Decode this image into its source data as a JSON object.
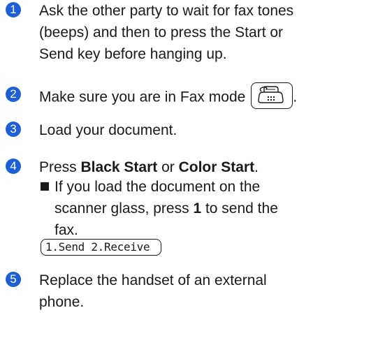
{
  "steps": [
    {
      "num": "1",
      "lines": [
        "Ask the other party to wait for fax tones",
        "(beeps) and then to press the Start or",
        "Send key before hanging up."
      ]
    },
    {
      "num": "2",
      "text": "Make sure you are in Fax mode",
      "trailing": ".",
      "icon": "fax-mode-key-icon"
    },
    {
      "num": "3",
      "text": "Load your document."
    },
    {
      "num": "4",
      "prefix": "Press ",
      "bold1": "Black Start",
      "middle": " or ",
      "bold2": "Color Start",
      "suffix": ".",
      "bullet": {
        "line1": "If you load the document on the",
        "line2_pre": "scanner glass, press ",
        "line2_bold": "1",
        "line2_post": " to send the",
        "line3": "fax."
      }
    },
    {
      "num": "5",
      "lines": [
        "Replace the handset of an external",
        "phone."
      ]
    }
  ],
  "lcd": {
    "text": "1.Send 2.Receive"
  },
  "colors": {
    "badge": "#1e5fd6",
    "text": "#1a1a1a"
  }
}
